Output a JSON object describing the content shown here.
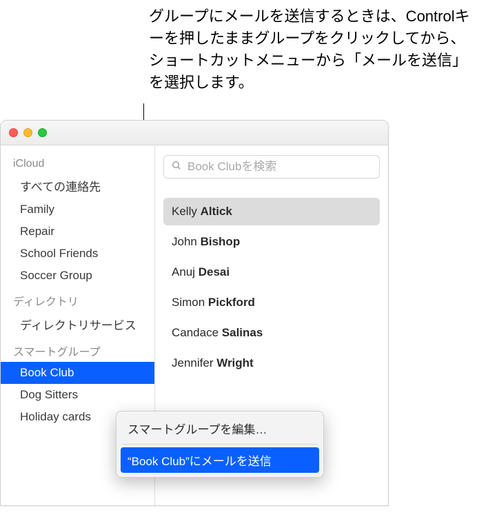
{
  "caption": "グループにメールを送信するときは、Controlキーを押したままグループをクリックしてから、ショートカットメニューから「メールを送信」を選択します。",
  "sidebar": {
    "sections": [
      {
        "header": "iCloud",
        "items": [
          {
            "label": "すべての連絡先",
            "selected": false
          },
          {
            "label": "Family",
            "selected": false
          },
          {
            "label": "Repair",
            "selected": false
          },
          {
            "label": "School Friends",
            "selected": false
          },
          {
            "label": "Soccer Group",
            "selected": false
          }
        ]
      },
      {
        "header": "ディレクトリ",
        "items": [
          {
            "label": "ディレクトリサービス",
            "selected": false
          }
        ]
      },
      {
        "header": "スマートグループ",
        "items": [
          {
            "label": "Book Club",
            "selected": true
          },
          {
            "label": "Dog Sitters",
            "selected": false
          },
          {
            "label": "Holiday cards",
            "selected": false
          }
        ]
      }
    ]
  },
  "search": {
    "placeholder": "Book Clubを検索"
  },
  "contacts": [
    {
      "first": "Kelly",
      "last": "Altick",
      "selected": true
    },
    {
      "first": "John",
      "last": "Bishop",
      "selected": false
    },
    {
      "first": "Anuj",
      "last": "Desai",
      "selected": false
    },
    {
      "first": "Simon",
      "last": "Pickford",
      "selected": false
    },
    {
      "first": "Candace",
      "last": "Salinas",
      "selected": false
    },
    {
      "first": "Jennifer",
      "last": "Wright",
      "selected": false
    }
  ],
  "context_menu": {
    "items": [
      {
        "label": "スマートグループを編集…",
        "highlighted": false
      },
      {
        "label": "“Book Club”にメールを送信",
        "highlighted": true
      }
    ]
  }
}
